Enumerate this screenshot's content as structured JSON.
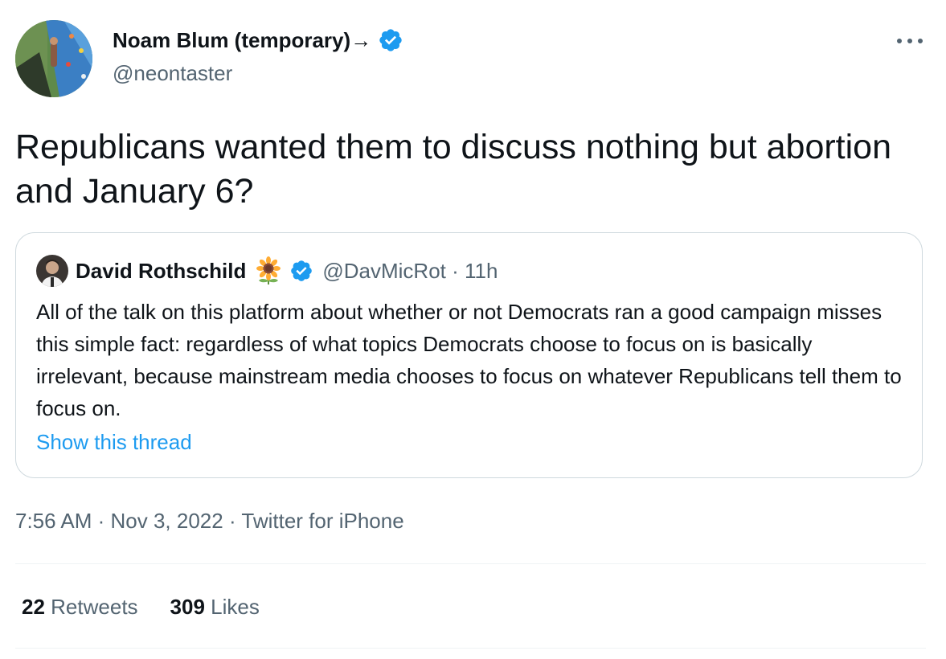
{
  "author": {
    "name": "Noam Blum (temporary)→",
    "handle": "@neontaster",
    "verified": true,
    "avatar_icon": "climbing-wall-photo"
  },
  "more_icon": "more-horizontal-icon",
  "tweet": {
    "text": "Republicans wanted them to discuss nothing but abortion and January 6?"
  },
  "quote": {
    "name": "David Rothschild",
    "emoji": "sunflower-emoji",
    "verified": true,
    "handle_time": "@DavMicRot · 11h",
    "text": "All of the talk on this platform about whether or not Democrats ran a good campaign misses this simple fact: regardless of what topics Democrats choose to focus on is basically irrelevant, because mainstream media chooses to focus on whatever Republicans tell them to focus on.",
    "show_thread": "Show this thread"
  },
  "meta": {
    "time": "7:56 AM",
    "separator": " · ",
    "date": "Nov 3, 2022",
    "source": "Twitter for iPhone"
  },
  "stats": {
    "retweets_count": "22",
    "retweets_label": "Retweets",
    "likes_count": "309",
    "likes_label": "Likes"
  },
  "colors": {
    "text": "#0f1419",
    "secondary": "#536471",
    "accent": "#1d9bf0",
    "border": "#cfd9de",
    "divider": "#eff3f4"
  }
}
